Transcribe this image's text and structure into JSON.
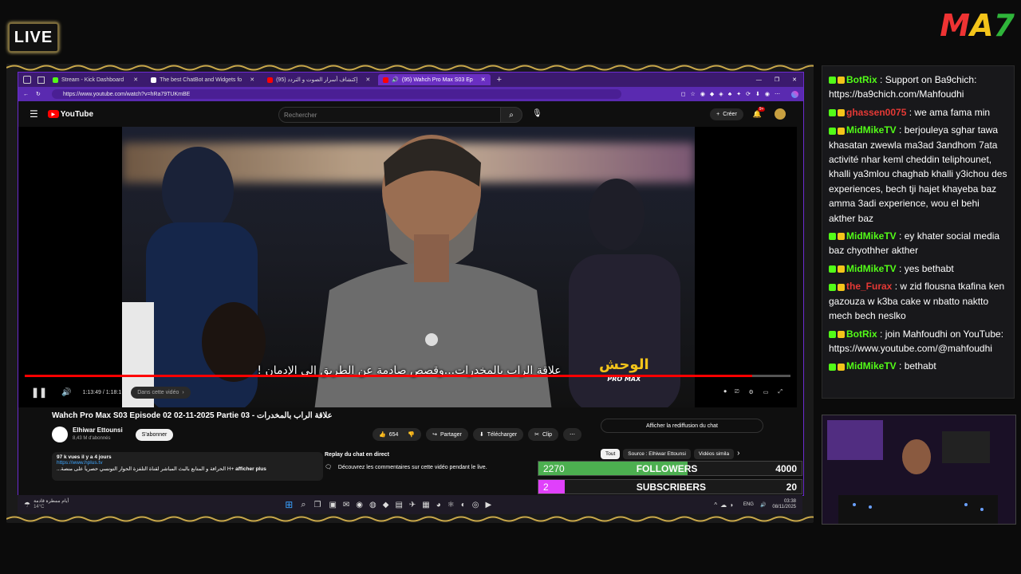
{
  "overlay": {
    "live_label": "LIVE",
    "logo": {
      "m": "M",
      "a": "A",
      "n": "7"
    },
    "colors": {
      "live_border": "#7a6a3a",
      "accent_purple": "#6b2bd0",
      "followers_bar": "#4caf50",
      "subscribers_bar": "#e040fb"
    }
  },
  "browser": {
    "tabs": [
      {
        "label": "Stream - Kick Dashboard",
        "color": "#53fc18"
      },
      {
        "label": "The best ChatBot and Widgets fo",
        "color": "#ffffff"
      },
      {
        "label": "إكتشاف أسرار الصوت و التردد (95)",
        "color": "#ff0000"
      },
      {
        "label": "(95) Wahch Pro Max S03 Ep",
        "color": "#ff0000",
        "active": true
      }
    ],
    "url": "https://www.youtube.com/watch?v=hRa79TUKmBE"
  },
  "youtube": {
    "logo_text": "YouTube",
    "search_placeholder": "Rechercher",
    "create_label": "Créer",
    "notif_count": "9+",
    "subtitle": "علاقة الراب بالمخدرات...وقصص صادمة عن الطريق إلى الإدمان !",
    "show_logo": "الوحش",
    "show_logo_sub": "PRO MAX",
    "progress_fraction": 0.95,
    "time": "1:13:49 / 1:18:1",
    "chapter": "Dans cette vidéo",
    "video_title": "Wahch Pro Max S03 Episode 02 02-11-2025 Partie 03 - علاقة الراب بالمخدرات",
    "channel_name": "Elhiwar Ettounsi",
    "subscribers": "8,43 M d'abonnés",
    "subscribe_label": "S'abonner",
    "likes": "654",
    "share_label": "Partager",
    "download_label": "Télécharger",
    "clip_label": "Clip",
    "views_line": "97 k vues  il y a 4 jours",
    "desc_link": "https://www.hplus.tv",
    "desc_text": "...الحرافة و المتابع بالبث المباشر لقناة التلفزة الحوار التونسي حصرياً على منصة H+ ",
    "desc_more": "afficher plus",
    "replay_title": "Replay du chat en direct",
    "replay_text": "Découvrez les commentaires sur cette vidéo pendant le live.",
    "show_chat_replay": "Afficher la rediffusion du chat",
    "chips": [
      "Tout",
      "Source : Elhiwar Ettounsi",
      "Vidéos simila"
    ]
  },
  "goals": {
    "followers": {
      "current": "2270",
      "label": "FOLLOWERS",
      "target": "4000",
      "fraction": 0.5675
    },
    "subscribers": {
      "current": "2",
      "label": "SUBSCRIBERS",
      "target": "20",
      "fraction": 0.1
    }
  },
  "taskbar": {
    "weather_text": "أيام ممطرة قادمة",
    "temp": "14°C",
    "lang": "ENG",
    "time": "03:38",
    "date": "08/11/2025"
  },
  "chat": {
    "messages": [
      {
        "user": "BotRix",
        "user_color": "#53fc18",
        "text": "Support on Ba9chich: https://ba9chich.com/Mahfoudhi"
      },
      {
        "user": "ghassen0075",
        "user_color": "#e53935",
        "text": "we ama fama min"
      },
      {
        "user": "MidMikeTV",
        "user_color": "#53fc18",
        "text": "berjouleya sghar tawa khasatan zwewla ma3ad 3andhom 7ata activité nhar keml cheddin teliphounet, khalli ya3mlou chaghab khalli y3ichou des experiences, bech tji hajet khayeba baz amma 3adi experience, wou el behi akther baz"
      },
      {
        "user": "MidMikeTV",
        "user_color": "#53fc18",
        "text": "ey khater social media baz chyothher akther"
      },
      {
        "user": "MidMikeTV",
        "user_color": "#53fc18",
        "text": "yes bethabt"
      },
      {
        "user": "the_Furax",
        "user_color": "#e53935",
        "text": "w zid flousna tkafina ken gazouza w k3ba cake w nbatto naktto mech bech neslko"
      },
      {
        "user": "BotRix",
        "user_color": "#53fc18",
        "text": "join Mahfoudhi on YouTube: https://www.youtube.com/@mahfoudhi"
      },
      {
        "user": "MidMikeTV",
        "user_color": "#53fc18",
        "text": "bethabt"
      }
    ]
  }
}
